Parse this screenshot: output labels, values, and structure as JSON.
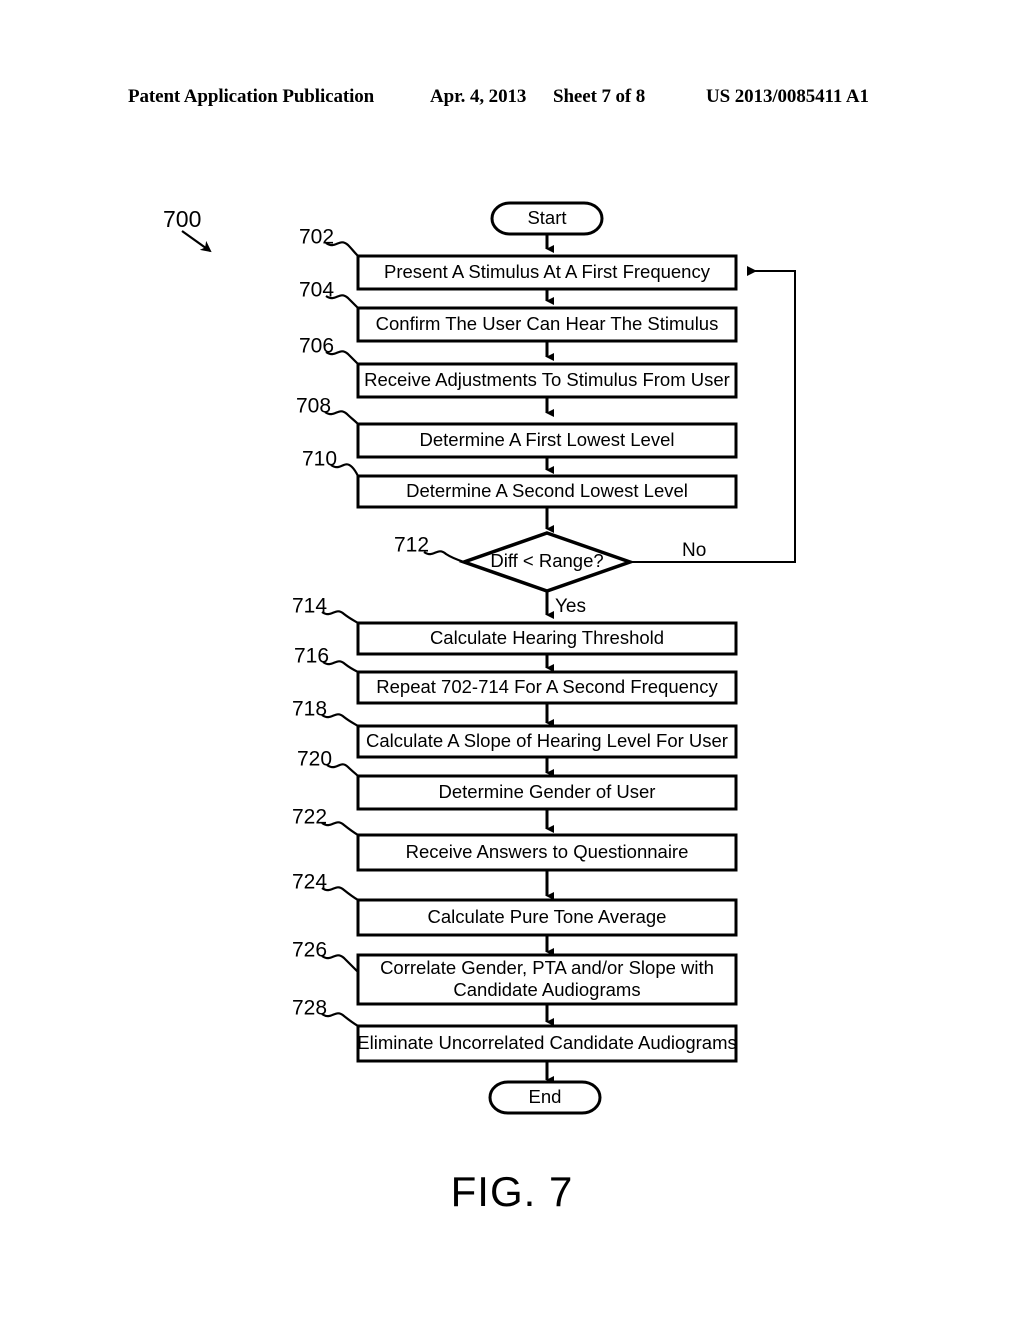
{
  "header": {
    "publication": "Patent Application Publication",
    "date": "Apr. 4, 2013",
    "sheet": "Sheet 7 of 8",
    "patent_number": "US 2013/0085411 A1"
  },
  "figure": {
    "caption": "FIG. 7",
    "diagram_ref": "700"
  },
  "flowchart": {
    "start_label": "Start",
    "end_label": "End",
    "branch_yes": "Yes",
    "branch_no": "No",
    "steps": [
      {
        "ref": "702",
        "text": "Present A Stimulus At A First Frequency"
      },
      {
        "ref": "704",
        "text": "Confirm The User Can Hear The Stimulus"
      },
      {
        "ref": "706",
        "text": "Receive Adjustments To Stimulus From User"
      },
      {
        "ref": "708",
        "text": "Determine A First Lowest Level"
      },
      {
        "ref": "710",
        "text": "Determine A Second Lowest Level"
      },
      {
        "ref": "712",
        "text": "Diff < Range?"
      },
      {
        "ref": "714",
        "text": "Calculate Hearing Threshold"
      },
      {
        "ref": "716",
        "text": "Repeat 702-714 For A Second Frequency"
      },
      {
        "ref": "718",
        "text": "Calculate A Slope of Hearing Level For User"
      },
      {
        "ref": "720",
        "text": "Determine Gender of User"
      },
      {
        "ref": "722",
        "text": "Receive Answers to Questionnaire"
      },
      {
        "ref": "724",
        "text": "Calculate Pure Tone Average"
      },
      {
        "ref": "726",
        "text": "Correlate Gender, PTA and/or Slope with",
        "text_line2": "Candidate Audiograms"
      },
      {
        "ref": "728",
        "text": "Eliminate Uncorrelated Candidate Audiograms"
      }
    ]
  },
  "colors": {
    "ink": "#000000",
    "paper": "#ffffff"
  }
}
